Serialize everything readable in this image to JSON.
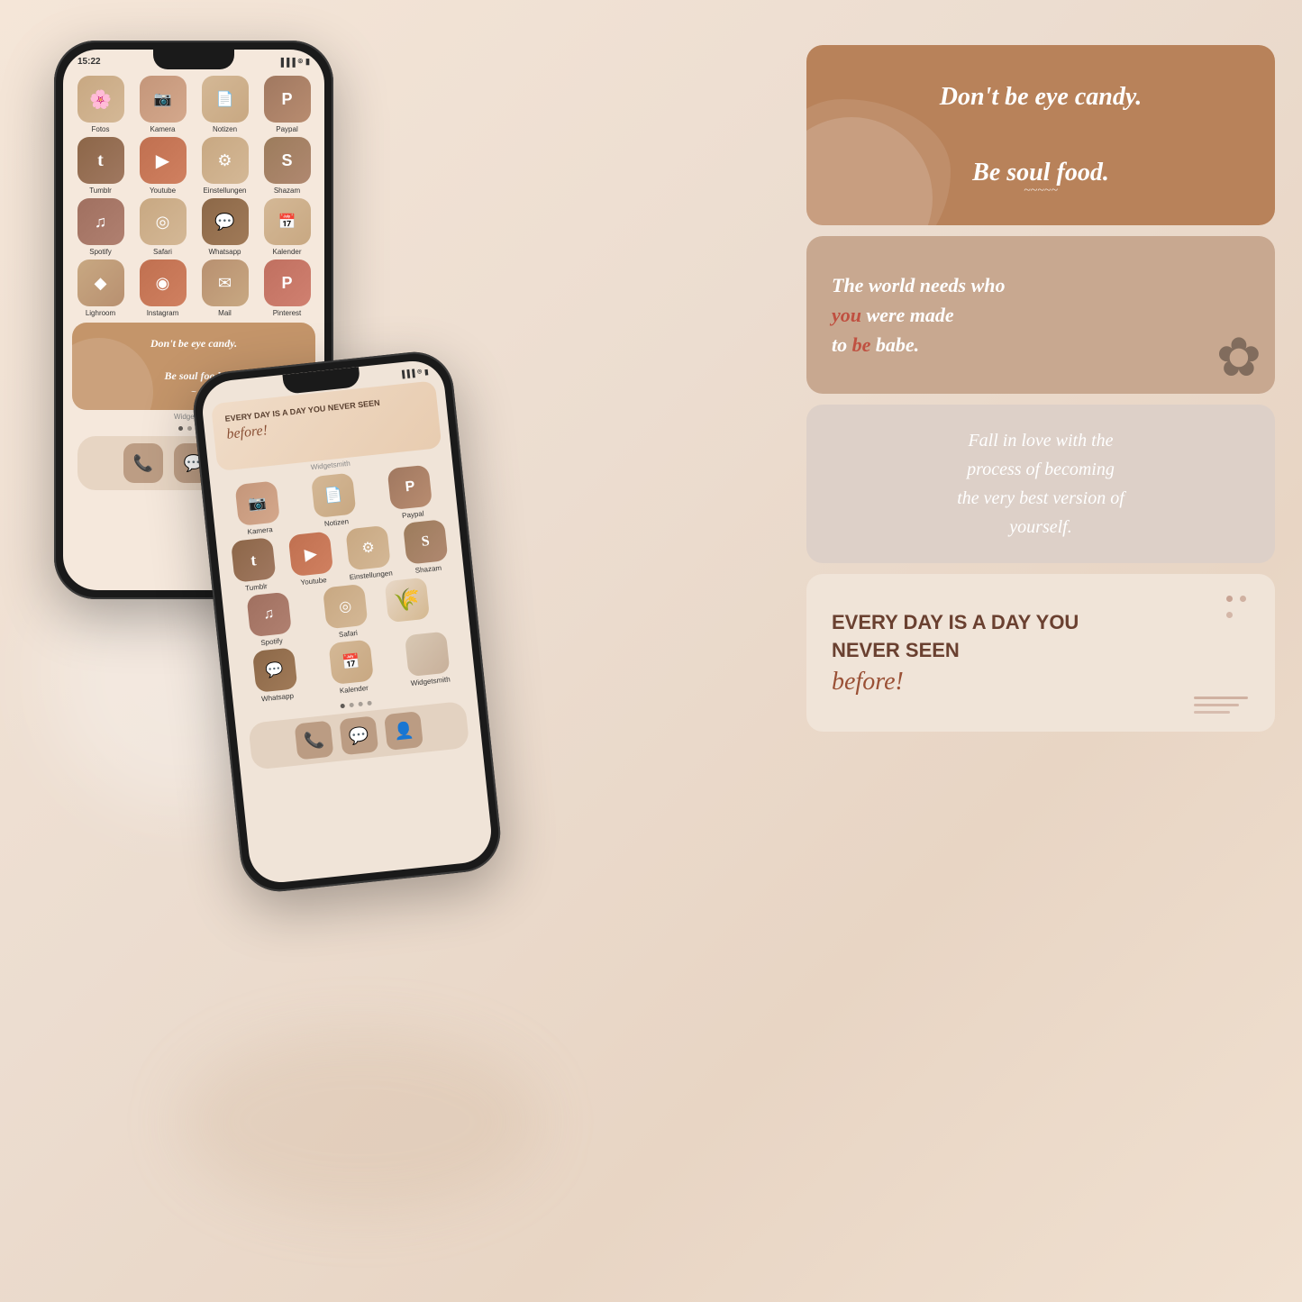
{
  "background": {
    "color": "#f0ddd0"
  },
  "phone1": {
    "status_time": "15:22",
    "apps_row1": [
      {
        "label": "Fotos",
        "icon": "🌸"
      },
      {
        "label": "Kamera",
        "icon": "📷"
      },
      {
        "label": "Notizen",
        "icon": "📄"
      },
      {
        "label": "Paypal",
        "icon": "P"
      }
    ],
    "apps_row2": [
      {
        "label": "Tumblr",
        "icon": "t"
      },
      {
        "label": "Youtube",
        "icon": "▶"
      },
      {
        "label": "Einstellungen",
        "icon": "⚙"
      },
      {
        "label": "Shazam",
        "icon": "S"
      }
    ],
    "apps_row3": [
      {
        "label": "Spotify",
        "icon": "♪"
      },
      {
        "label": "Safari",
        "icon": "◎"
      },
      {
        "label": "Whatsapp",
        "icon": "💬"
      },
      {
        "label": "Kalender",
        "icon": "📅"
      }
    ],
    "apps_row4": [
      {
        "label": "Lighroom",
        "icon": "◆"
      },
      {
        "label": "Instagram",
        "icon": "◉"
      },
      {
        "label": "Mail",
        "icon": "✉"
      },
      {
        "label": "Pinterest",
        "icon": "P"
      }
    ],
    "widget_text": "Don't be eye candy.\n\nBe soul food.",
    "widget_label": "Widgetsmith",
    "dock": [
      "📞",
      "💬",
      "👤"
    ]
  },
  "phone2": {
    "widget2_text": "EVERY DAY IS A DAY YOU NEVER SEEN",
    "widget2_cursive": "before!",
    "widget_label": "Widgetsmith",
    "apps_row1": [
      {
        "label": "Kamera",
        "icon": "📷"
      },
      {
        "label": "Notizen",
        "icon": "📄"
      },
      {
        "label": "Paypal",
        "icon": "P"
      }
    ],
    "apps_row2": [
      {
        "label": "Tumblr",
        "icon": "t"
      },
      {
        "label": "Youtube",
        "icon": "▶"
      },
      {
        "label": "Einstellungen",
        "icon": "⚙"
      },
      {
        "label": "Shazam",
        "icon": "S"
      }
    ],
    "apps_row3": [
      {
        "label": "Spotify",
        "icon": "♪"
      },
      {
        "label": "Safari",
        "icon": "◎"
      }
    ],
    "apps_row4": [
      {
        "label": "Whatsapp",
        "icon": "💬"
      },
      {
        "label": "Kalender",
        "icon": "📅"
      }
    ],
    "dock": [
      "📞",
      "💬",
      "👤"
    ]
  },
  "cards": [
    {
      "id": "card1",
      "text": "Don't be eye candy.\n\nBe soul food.",
      "style": "brown"
    },
    {
      "id": "card2",
      "line1": "The world needs who",
      "line2_before": "",
      "line2_you": "you",
      "line2_after": " were made",
      "line3": "to ",
      "line3_be": "be",
      "line3_after": " babe.",
      "style": "light-brown"
    },
    {
      "id": "card3",
      "text": "Fall in love with the process of becoming the very best version of yourself.",
      "style": "beige"
    },
    {
      "id": "card4",
      "line1": "EVERY DAY IS A DAY YOU",
      "line2": "NEVER SEEN",
      "cursive": "before!",
      "style": "light-peach"
    }
  ]
}
